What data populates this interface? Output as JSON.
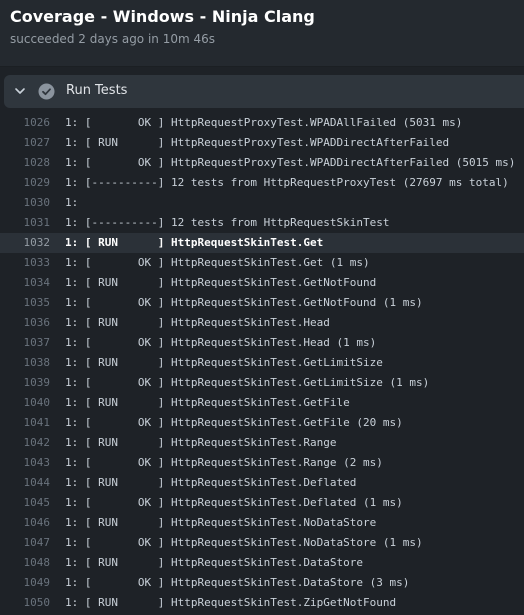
{
  "header": {
    "title": "Coverage - Windows - Ninja Clang",
    "subtitle": "succeeded 2 days ago in 10m 46s"
  },
  "step": {
    "title": "Run Tests",
    "status_icon": "check-circle-icon",
    "expand_icon": "chevron-down-icon"
  },
  "log": {
    "highlighted_line": "1032",
    "lines": [
      {
        "n": "1026",
        "t": "1: [       OK ] HttpRequestProxyTest.WPADAllFailed (5031 ms)"
      },
      {
        "n": "1027",
        "t": "1: [ RUN      ] HttpRequestProxyTest.WPADDirectAfterFailed"
      },
      {
        "n": "1028",
        "t": "1: [       OK ] HttpRequestProxyTest.WPADDirectAfterFailed (5015 ms)"
      },
      {
        "n": "1029",
        "t": "1: [----------] 12 tests from HttpRequestProxyTest (27697 ms total)"
      },
      {
        "n": "1030",
        "t": "1:"
      },
      {
        "n": "1031",
        "t": "1: [----------] 12 tests from HttpRequestSkinTest"
      },
      {
        "n": "1032",
        "t": "1: [ RUN      ] HttpRequestSkinTest.Get"
      },
      {
        "n": "1033",
        "t": "1: [       OK ] HttpRequestSkinTest.Get (1 ms)"
      },
      {
        "n": "1034",
        "t": "1: [ RUN      ] HttpRequestSkinTest.GetNotFound"
      },
      {
        "n": "1035",
        "t": "1: [       OK ] HttpRequestSkinTest.GetNotFound (1 ms)"
      },
      {
        "n": "1036",
        "t": "1: [ RUN      ] HttpRequestSkinTest.Head"
      },
      {
        "n": "1037",
        "t": "1: [       OK ] HttpRequestSkinTest.Head (1 ms)"
      },
      {
        "n": "1038",
        "t": "1: [ RUN      ] HttpRequestSkinTest.GetLimitSize"
      },
      {
        "n": "1039",
        "t": "1: [       OK ] HttpRequestSkinTest.GetLimitSize (1 ms)"
      },
      {
        "n": "1040",
        "t": "1: [ RUN      ] HttpRequestSkinTest.GetFile"
      },
      {
        "n": "1041",
        "t": "1: [       OK ] HttpRequestSkinTest.GetFile (20 ms)"
      },
      {
        "n": "1042",
        "t": "1: [ RUN      ] HttpRequestSkinTest.Range"
      },
      {
        "n": "1043",
        "t": "1: [       OK ] HttpRequestSkinTest.Range (2 ms)"
      },
      {
        "n": "1044",
        "t": "1: [ RUN      ] HttpRequestSkinTest.Deflated"
      },
      {
        "n": "1045",
        "t": "1: [       OK ] HttpRequestSkinTest.Deflated (1 ms)"
      },
      {
        "n": "1046",
        "t": "1: [ RUN      ] HttpRequestSkinTest.NoDataStore"
      },
      {
        "n": "1047",
        "t": "1: [       OK ] HttpRequestSkinTest.NoDataStore (1 ms)"
      },
      {
        "n": "1048",
        "t": "1: [ RUN      ] HttpRequestSkinTest.DataStore"
      },
      {
        "n": "1049",
        "t": "1: [       OK ] HttpRequestSkinTest.DataStore (3 ms)"
      },
      {
        "n": "1050",
        "t": "1: [ RUN      ] HttpRequestSkinTest.ZipGetNotFound"
      }
    ]
  },
  "colors": {
    "background": "#24292f",
    "panel": "#1e2227",
    "step_header": "#2f363d",
    "success": "#c9d1d9",
    "line_number": "#6a737d"
  }
}
